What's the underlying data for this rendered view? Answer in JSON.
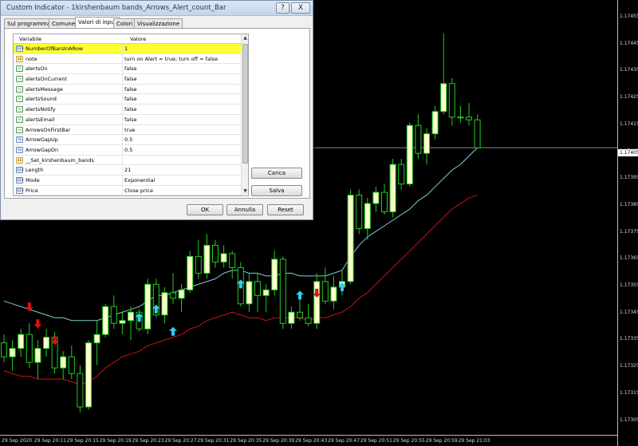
{
  "dialog": {
    "title": "Custom Indicator - 1kirshenbaum bands_Arrows_Alert_count_Bar",
    "help_glyph": "?",
    "close_glyph": "X",
    "tabs": [
      "Sul programma",
      "Comune",
      "Valori di input",
      "Colori",
      "Visualizzazione"
    ],
    "active_tab": "Valori di input",
    "grid_headers": {
      "variable": "Variabile",
      "value": "Valore"
    },
    "params": [
      {
        "icon": "123",
        "name": "NumberOfBarsInARow",
        "value": "1",
        "highlight": true
      },
      {
        "icon": "ab",
        "name": "note",
        "value": "turn on Alert = true; turn off = false"
      },
      {
        "icon": "bool",
        "name": "alertsOn",
        "value": "false"
      },
      {
        "icon": "bool",
        "name": "alertsOnCurrent",
        "value": "false"
      },
      {
        "icon": "bool",
        "name": "alertsMessage",
        "value": "false"
      },
      {
        "icon": "bool",
        "name": "alertsSound",
        "value": "false"
      },
      {
        "icon": "bool",
        "name": "alertsNotify",
        "value": "false"
      },
      {
        "icon": "bool",
        "name": "alertsEmail",
        "value": "false"
      },
      {
        "icon": "bool",
        "name": "ArrowsOnFirstBar",
        "value": "true"
      },
      {
        "icon": "1/2",
        "name": "ArrowGapUp",
        "value": "0.5"
      },
      {
        "icon": "1/2",
        "name": "ArrowGapDn",
        "value": "0.5"
      },
      {
        "icon": "ab",
        "name": "__Set_kirshenbaum_bands",
        "value": ""
      },
      {
        "icon": "123",
        "name": "Length",
        "value": "21"
      },
      {
        "icon": "123",
        "name": "Mode",
        "value": "Exponential"
      },
      {
        "icon": "123",
        "name": "Price",
        "value": "Close price"
      }
    ],
    "buttons": {
      "load": "Carica",
      "save": "Salva",
      "ok": "OK",
      "cancel": "Annulla",
      "reset": "Reset"
    }
  },
  "price_axis": {
    "labels": [
      "1.17455",
      "1.17445",
      "1.17435",
      "1.17425",
      "1.17415",
      "1.17405",
      "1.17395",
      "1.17385",
      "1.17375",
      "1.17365",
      "1.17355",
      "1.17345",
      "1.17335",
      "1.17325",
      "1.17315",
      "1.17305"
    ],
    "current": "1.17405"
  },
  "time_axis": {
    "labels": [
      "29 Sep 2020",
      "29 Sep 20:11",
      "29 Sep 20:15",
      "29 Sep 20:19",
      "29 Sep 20:23",
      "29 Sep 20:27",
      "29 Sep 20:31",
      "29 Sep 20:35",
      "29 Sep 20:39",
      "29 Sep 20:43",
      "29 Sep 20:47",
      "29 Sep 20:51",
      "29 Sep 20:55",
      "29 Sep 20:59",
      "29 Sep 21:03"
    ]
  },
  "colors": {
    "background": "#000000",
    "candle_up": "#ffffcc",
    "candle_down": "#000000",
    "wick": "#22cc22",
    "upper_band": "#7ecfd6",
    "lower_band": "#cc1111",
    "arrow_up": "#33ccee",
    "arrow_down": "#dd1111",
    "highlight": "#ffff33"
  },
  "chart_data": {
    "type": "candlestick",
    "candles": [
      [
        1.17335,
        1.17338,
        1.17328,
        1.1733
      ],
      [
        1.1733,
        1.17336,
        1.17325,
        1.17333
      ],
      [
        1.17333,
        1.1734,
        1.1733,
        1.17338
      ],
      [
        1.17338,
        1.17342,
        1.17326,
        1.17328
      ],
      [
        1.17328,
        1.17336,
        1.17322,
        1.17333
      ],
      [
        1.17333,
        1.1734,
        1.1733,
        1.17337
      ],
      [
        1.17337,
        1.17339,
        1.17324,
        1.17326
      ],
      [
        1.17326,
        1.17332,
        1.17322,
        1.1733
      ],
      [
        1.1733,
        1.17334,
        1.17322,
        1.17324
      ],
      [
        1.17324,
        1.17327,
        1.1731,
        1.17312
      ],
      [
        1.17312,
        1.17336,
        1.17311,
        1.17335
      ],
      [
        1.17335,
        1.17343,
        1.17327,
        1.17338
      ],
      [
        1.17338,
        1.17349,
        1.17337,
        1.17348
      ],
      [
        1.17348,
        1.17352,
        1.1734,
        1.17342
      ],
      [
        1.17342,
        1.17346,
        1.17338,
        1.17343
      ],
      [
        1.17343,
        1.17348,
        1.17336,
        1.17346
      ],
      [
        1.17346,
        1.17347,
        1.17339,
        1.1734
      ],
      [
        1.1734,
        1.17358,
        1.17338,
        1.17356
      ],
      [
        1.17356,
        1.17358,
        1.17344,
        1.17345
      ],
      [
        1.17345,
        1.17355,
        1.17342,
        1.17353
      ],
      [
        1.17353,
        1.1736,
        1.17349,
        1.17351
      ],
      [
        1.17351,
        1.17356,
        1.17346,
        1.17354
      ],
      [
        1.17354,
        1.17368,
        1.17353,
        1.17366
      ],
      [
        1.17366,
        1.17372,
        1.17358,
        1.1736
      ],
      [
        1.1736,
        1.17374,
        1.17358,
        1.1737
      ],
      [
        1.1737,
        1.17372,
        1.17362,
        1.17364
      ],
      [
        1.17364,
        1.1737,
        1.17362,
        1.17367
      ],
      [
        1.17367,
        1.17368,
        1.17358,
        1.17362
      ],
      [
        1.17362,
        1.17364,
        1.17348,
        1.17349
      ],
      [
        1.17349,
        1.1736,
        1.17346,
        1.17357
      ],
      [
        1.17357,
        1.1736,
        1.17346,
        1.17352
      ],
      [
        1.17352,
        1.17356,
        1.17346,
        1.17354
      ],
      [
        1.17354,
        1.17368,
        1.17352,
        1.17365
      ],
      [
        1.17365,
        1.17366,
        1.1734,
        1.17342
      ],
      [
        1.17342,
        1.17348,
        1.1734,
        1.17346
      ],
      [
        1.17346,
        1.17352,
        1.17343,
        1.17344
      ],
      [
        1.17344,
        1.17349,
        1.17341,
        1.17342
      ],
      [
        1.17342,
        1.1736,
        1.1734,
        1.17357
      ],
      [
        1.17357,
        1.17362,
        1.17349,
        1.1735
      ],
      [
        1.1735,
        1.17359,
        1.17347,
        1.17355
      ],
      [
        1.17355,
        1.17361,
        1.17352,
        1.17357
      ],
      [
        1.17357,
        1.1739,
        1.17356,
        1.17388
      ],
      [
        1.17388,
        1.1739,
        1.17374,
        1.17376
      ],
      [
        1.17376,
        1.17387,
        1.17372,
        1.17385
      ],
      [
        1.17385,
        1.17391,
        1.17382,
        1.17389
      ],
      [
        1.17389,
        1.17392,
        1.17381,
        1.17382
      ],
      [
        1.17382,
        1.17401,
        1.1738,
        1.17399
      ],
      [
        1.17399,
        1.17401,
        1.1739,
        1.17392
      ],
      [
        1.17392,
        1.17414,
        1.17391,
        1.17413
      ],
      [
        1.17413,
        1.17417,
        1.17401,
        1.17403
      ],
      [
        1.17403,
        1.17412,
        1.17399,
        1.1741
      ],
      [
        1.1741,
        1.1742,
        1.17408,
        1.17418
      ],
      [
        1.17418,
        1.17446,
        1.17417,
        1.17428
      ],
      [
        1.17428,
        1.1743,
        1.17413,
        1.17416
      ],
      [
        1.17416,
        1.1742,
        1.17414,
        1.17416
      ],
      [
        1.17416,
        1.17421,
        1.17413,
        1.17415
      ],
      [
        1.17415,
        1.17417,
        1.17405,
        1.17405
      ]
    ],
    "upper_band": [
      1.1735,
      1.17349,
      1.17348,
      1.17347,
      1.17346,
      1.17345,
      1.17344,
      1.17344,
      1.17343,
      1.17343,
      1.17343,
      1.17343,
      1.17344,
      1.17345,
      1.17346,
      1.17347,
      1.17348,
      1.1735,
      1.17352,
      1.17352,
      1.17353,
      1.17354,
      1.17355,
      1.17356,
      1.17357,
      1.17358,
      1.1736,
      1.17361,
      1.17361,
      1.1736,
      1.1736,
      1.17359,
      1.17359,
      1.1736,
      1.1736,
      1.17359,
      1.17359,
      1.17359,
      1.17359,
      1.1736,
      1.17361,
      1.17366,
      1.1737,
      1.17373,
      1.17375,
      1.17377,
      1.17379,
      1.17381,
      1.17383,
      1.17386,
      1.17388,
      1.17391,
      1.17394,
      1.17397,
      1.17399,
      1.17402,
      1.17405
    ],
    "lower_band": [
      1.17325,
      1.17324,
      1.17323,
      1.17323,
      1.17322,
      1.17322,
      1.17322,
      1.17322,
      1.17321,
      1.1732,
      1.17321,
      1.17323,
      1.17326,
      1.17328,
      1.1733,
      1.17331,
      1.17332,
      1.17334,
      1.17335,
      1.17336,
      1.17337,
      1.17338,
      1.1734,
      1.17341,
      1.17343,
      1.17344,
      1.17345,
      1.17346,
      1.17345,
      1.17344,
      1.17344,
      1.17343,
      1.17344,
      1.17344,
      1.17344,
      1.17344,
      1.17343,
      1.17344,
      1.17344,
      1.17345,
      1.17346,
      1.17348,
      1.17351,
      1.17353,
      1.17356,
      1.17359,
      1.17362,
      1.17365,
      1.17368,
      1.17371,
      1.17374,
      1.17377,
      1.1738,
      1.17383,
      1.17385,
      1.17387,
      1.17388
    ],
    "up_arrows": [
      [
        16,
        1.17344
      ],
      [
        18,
        1.17347
      ],
      [
        20,
        1.17339
      ],
      [
        28,
        1.17356
      ],
      [
        35,
        1.17352
      ],
      [
        40,
        1.17355
      ]
    ],
    "down_arrows": [
      [
        3,
        1.17348
      ],
      [
        4,
        1.17342
      ],
      [
        6,
        1.17336
      ],
      [
        37,
        1.17353
      ]
    ],
    "ylim": [
      1.17302,
      1.17458
    ]
  }
}
